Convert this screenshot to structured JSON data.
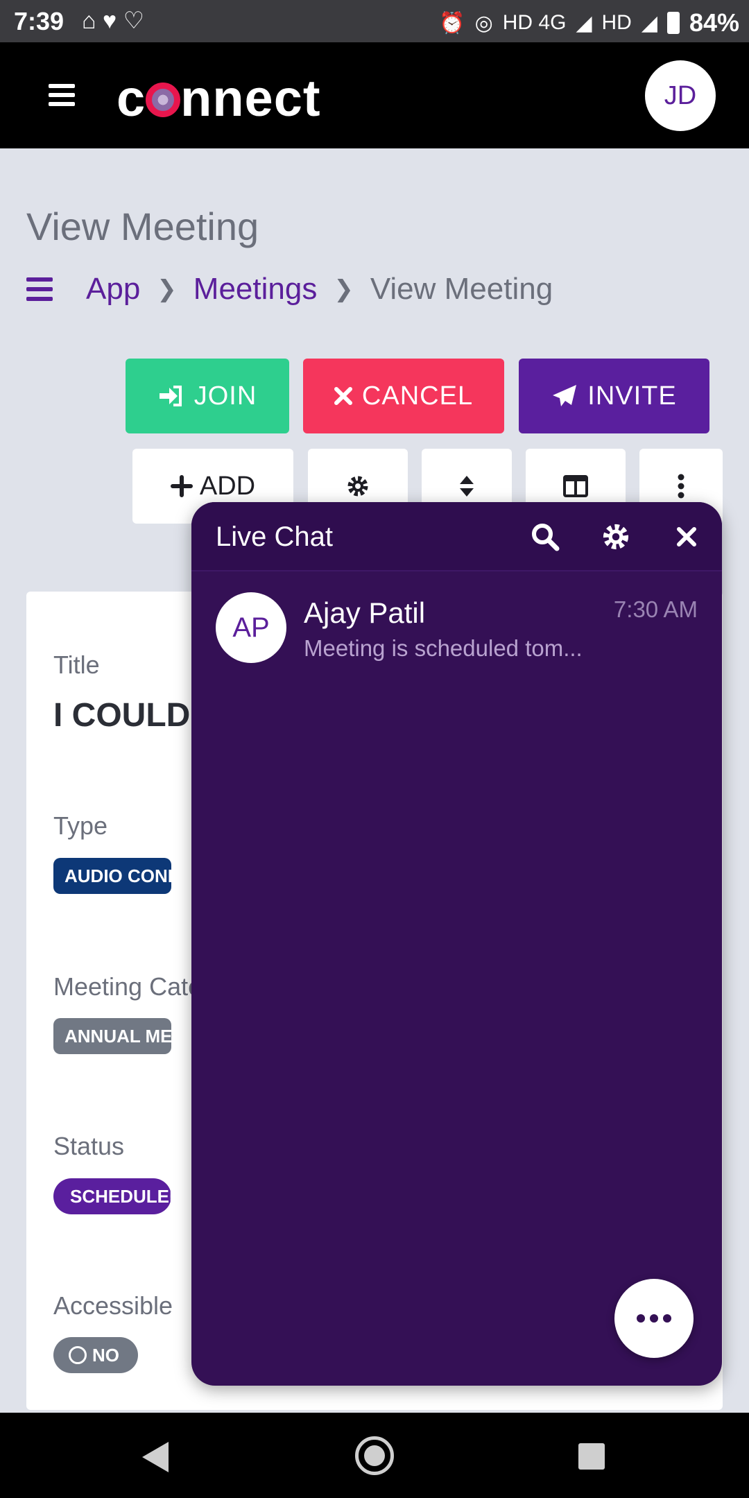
{
  "status_bar": {
    "time": "7:39",
    "network": "HD 4G",
    "network2": "HD",
    "battery": "84%"
  },
  "header": {
    "logo_text_pre": "c",
    "logo_text_post": "nnect",
    "user_initials": "JD"
  },
  "page": {
    "title": "View Meeting",
    "breadcrumb": [
      "App",
      "Meetings",
      "View Meeting"
    ]
  },
  "actions": {
    "join": "JOIN",
    "cancel": "CANCEL",
    "invite": "INVITE",
    "add": "ADD"
  },
  "meeting": {
    "title_label": "Title",
    "title_value": "I COULD",
    "type_label": "Type",
    "type_value": "AUDIO CONFERENCE",
    "category_label": "Meeting Category",
    "category_value": "ANNUAL MEETING",
    "status_label": "Status",
    "status_value": "SCHEDULED",
    "accessible_label": "Accessible",
    "accessible_value": "NO"
  },
  "chat": {
    "title": "Live Chat",
    "conversations": [
      {
        "initials": "AP",
        "name": "Ajay Patil",
        "preview": "Meeting is scheduled tom...",
        "time": "7:30 AM"
      }
    ]
  },
  "colors": {
    "brand_purple": "#5a1f9e",
    "join_green": "#2ecf8e",
    "cancel_red": "#f5365c",
    "chat_bg": "#341055"
  }
}
